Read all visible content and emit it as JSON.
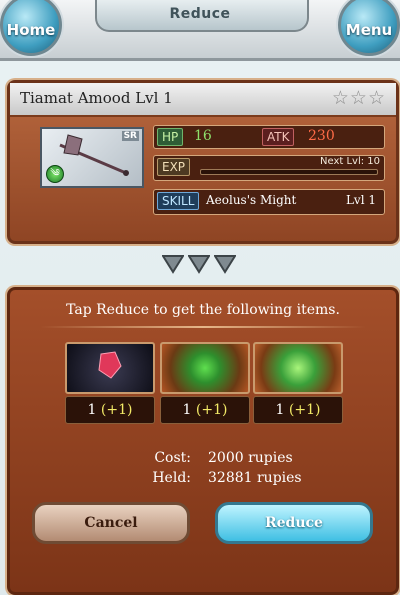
{
  "header": {
    "title": "Reduce",
    "home_label": "Home",
    "menu_label": "Menu"
  },
  "weapon": {
    "name": "Tiamat Amood Lvl 1",
    "stars": "☆☆☆",
    "rarity": "SR",
    "element_icon": "wind-element-icon",
    "hp_label": "HP",
    "hp_value": "16",
    "atk_label": "ATK",
    "atk_value": "230",
    "exp_label": "EXP",
    "next_level": "Next Lvl:  10",
    "exp_progress": 0.0,
    "skill_label": "SKILL",
    "skill_name": "Aeolus's Might",
    "skill_level": "Lvl  1"
  },
  "reduce_panel": {
    "message": "Tap Reduce to get the following items.",
    "items": [
      {
        "icon": "red-crystal-icon",
        "count": "1 ",
        "bonus": "(+1)"
      },
      {
        "icon": "green-orb-icon",
        "count": "1 ",
        "bonus": "(+1)"
      },
      {
        "icon": "green-whorl-icon",
        "count": "1 ",
        "bonus": "(+1)"
      }
    ],
    "cost_label": "Cost:",
    "cost_value": "2000 rupies",
    "held_label": "Held:",
    "held_value": "32881 rupies",
    "cancel_label": "Cancel",
    "reduce_label": "Reduce"
  },
  "colors": {
    "accent_blue": "#3fbfe3",
    "panel_brown": "#8f4524"
  }
}
